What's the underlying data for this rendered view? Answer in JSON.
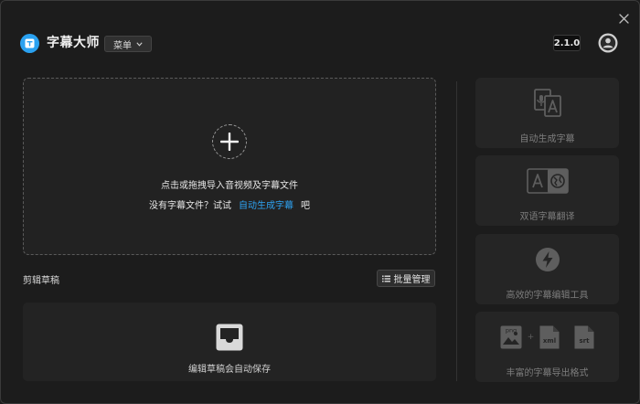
{
  "header": {
    "app_title": "字幕大师",
    "menu_label": "菜单",
    "version": "2.1.0"
  },
  "drop_zone": {
    "instruction": "点击或拖拽导入音视频及字幕文件",
    "no_subtitle_prefix": "没有字幕文件？试试",
    "auto_generate_link": "自动生成字幕",
    "no_subtitle_suffix": "吧"
  },
  "drafts": {
    "title": "剪辑草稿",
    "batch_manage_label": "批量管理",
    "autosave_text": "编辑草稿会自动保存"
  },
  "features": [
    {
      "label": "自动生成字幕",
      "icon": "auto-subtitle-icon"
    },
    {
      "label": "双语字幕翻译",
      "icon": "translate-icon"
    },
    {
      "label": "高效的字幕编辑工具",
      "icon": "lightning-icon"
    },
    {
      "label": "丰富的字幕导出格式",
      "icon": "export-formats-icon",
      "formats": [
        "png",
        "xml",
        "srt"
      ],
      "separator": "+"
    }
  ],
  "colors": {
    "accent": "#2ea3f2",
    "logo": "#2aa1f0",
    "background": "#1c1c1c",
    "card": "#252525"
  }
}
